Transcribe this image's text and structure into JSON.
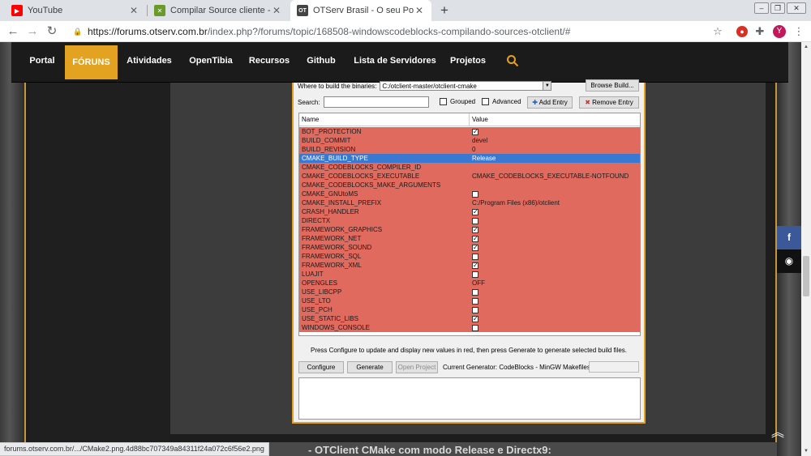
{
  "browser": {
    "tabs": [
      {
        "title": "YouTube",
        "favicon": "youtube-icon",
        "active": false
      },
      {
        "title": "Compilar Source cliente - Clients",
        "favicon": "codeblocks-icon",
        "active": false
      },
      {
        "title": "OTServ Brasil - O seu Portal para",
        "favicon": "otserv-icon",
        "active": true
      }
    ],
    "new_tab": "+",
    "url_host": "forums.otserv.com.br",
    "url_path": "/index.php?/forums/topic/168508-windowscodeblocks-compilando-sources-otclient/#",
    "avatar_letter": "Y"
  },
  "site": {
    "nav": [
      "Portal",
      "FÓRUNS",
      "Atividades",
      "OpenTibia",
      "Recursos",
      "Github",
      "Lista de Servidores",
      "Projetos"
    ],
    "accent": "#e3a321"
  },
  "cmake": {
    "where_build_label": "Where to build the binaries:",
    "where_build_value": "C:/otclient-master/otclient-cmake",
    "browse_build": "Browse Build...",
    "search_label": "Search:",
    "grouped_label": "Grouped",
    "advanced_label": "Advanced",
    "add_entry": "Add Entry",
    "remove_entry": "Remove Entry",
    "col_name": "Name",
    "col_value": "Value",
    "rows": [
      {
        "name": "BOT_PROTECTION",
        "value": "",
        "check": true
      },
      {
        "name": "BUILD_COMMIT",
        "value": "devel"
      },
      {
        "name": "BUILD_REVISION",
        "value": "0"
      },
      {
        "name": "CMAKE_BUILD_TYPE",
        "value": "Release",
        "selected": true
      },
      {
        "name": "CMAKE_CODEBLOCKS_COMPILER_ID",
        "value": ""
      },
      {
        "name": "CMAKE_CODEBLOCKS_EXECUTABLE",
        "value": "CMAKE_CODEBLOCKS_EXECUTABLE-NOTFOUND"
      },
      {
        "name": "CMAKE_CODEBLOCKS_MAKE_ARGUMENTS",
        "value": ""
      },
      {
        "name": "CMAKE_GNUtoMS",
        "value": "",
        "check": false
      },
      {
        "name": "CMAKE_INSTALL_PREFIX",
        "value": "C:/Program Files (x86)/otclient"
      },
      {
        "name": "CRASH_HANDLER",
        "value": "",
        "check": true
      },
      {
        "name": "DIRECTX",
        "value": "",
        "check": false
      },
      {
        "name": "FRAMEWORK_GRAPHICS",
        "value": "",
        "check": true
      },
      {
        "name": "FRAMEWORK_NET",
        "value": "",
        "check": true
      },
      {
        "name": "FRAMEWORK_SOUND",
        "value": "",
        "check": true
      },
      {
        "name": "FRAMEWORK_SQL",
        "value": "",
        "check": false
      },
      {
        "name": "FRAMEWORK_XML",
        "value": "",
        "check": true
      },
      {
        "name": "LUAJIT",
        "value": "",
        "check": false
      },
      {
        "name": "OPENGLES",
        "value": "OFF"
      },
      {
        "name": "USE_LIBCPP",
        "value": "",
        "check": false
      },
      {
        "name": "USE_LTO",
        "value": "",
        "check": false
      },
      {
        "name": "USE_PCH",
        "value": "",
        "check": false
      },
      {
        "name": "USE_STATIC_LIBS",
        "value": "",
        "check": true
      },
      {
        "name": "WINDOWS_CONSOLE",
        "value": "",
        "check": false
      }
    ],
    "hint": "Press Configure to update and display new values in red, then press Generate to generate selected build files.",
    "configure": "Configure",
    "generate": "Generate",
    "open_project": "Open Project",
    "current_generator": "Current Generator: CodeBlocks - MinGW Makefiles"
  },
  "post_heading": "- OTClient CMake com modo Release e Directx9:",
  "status_url": "forums.otserv.com.br/.../CMake2.png.4d88bc707349a84311f24a072c6f56e2.png"
}
